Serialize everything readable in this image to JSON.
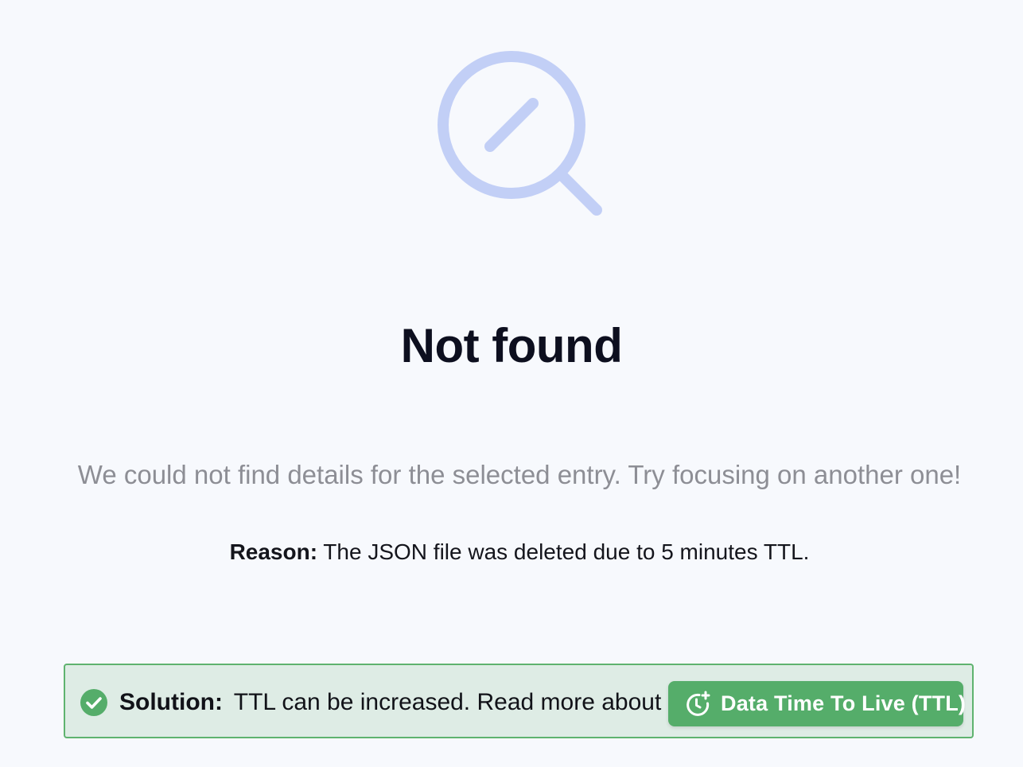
{
  "empty_state": {
    "icon": "search-icon",
    "title": "Not found",
    "description": "We could not find details for the selected entry. Try focusing on another one!",
    "reason_label": "Reason:",
    "reason_text": " The JSON file was deleted due to 5 minutes TTL."
  },
  "solution": {
    "icon": "check-circle-icon",
    "label": "Solution:",
    "text": "TTL can be increased. Read more about",
    "button_icon": "clock-plus-icon",
    "button_label": "Data Time To Live (TTL)"
  },
  "colors": {
    "background": "#f7f9fd",
    "icon_accent": "#c2cff6",
    "success_green": "#55ad6a",
    "solution_background": "#deece5",
    "solution_border": "#5fb36f"
  }
}
